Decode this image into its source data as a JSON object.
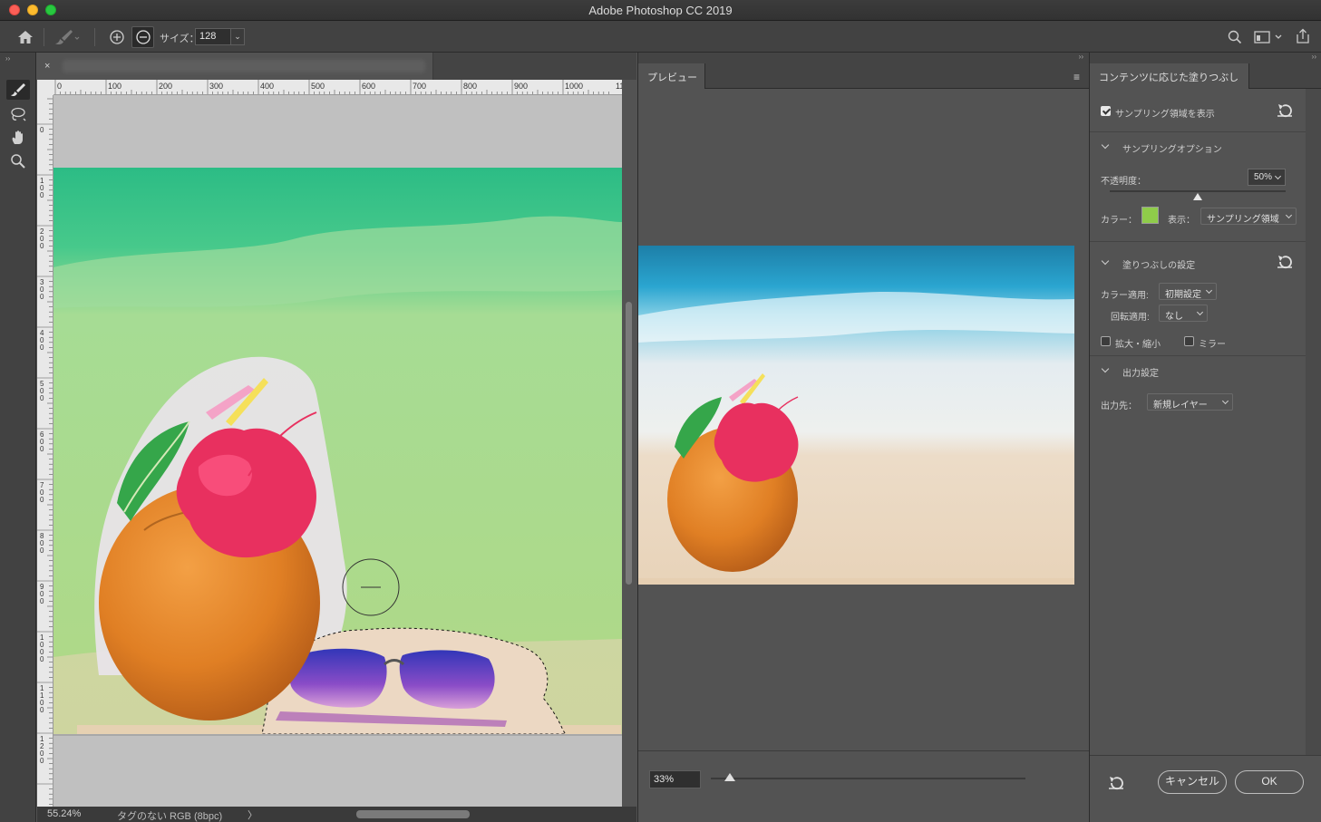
{
  "window": {
    "title": "Adobe Photoshop CC 2019"
  },
  "options_bar": {
    "size_label": "サイズ：",
    "size_value": "128"
  },
  "document": {
    "close_label": "×",
    "zoom": "55.24%",
    "color_info": "タグのない RGB (8bpc)",
    "status_arrow": "〉",
    "ruler_h": [
      "0",
      "100",
      "200",
      "300",
      "400",
      "500",
      "600",
      "700",
      "800",
      "900",
      "1000",
      "1100"
    ],
    "ruler_v": [
      "100",
      "0",
      "100",
      "200",
      "300",
      "400",
      "500",
      "600",
      "700",
      "800",
      "900",
      "1000",
      "1100",
      "1200"
    ]
  },
  "preview": {
    "tab_label": "プレビュー",
    "zoom_value": "33%",
    "zoom_fraction": 0.06
  },
  "settings": {
    "tab_label": "コンテンツに応じた塗りつぶし",
    "show_sampling_label": "サンプリング領域を表示",
    "show_sampling_checked": true,
    "sampling_section": "サンプリングオプション",
    "opacity_label": "不透明度：",
    "opacity_value": "50%",
    "opacity_fraction": 0.5,
    "color_label": "カラー：",
    "color_swatch": "#8fcc4a",
    "display_label": "表示：",
    "display_value": "サンプリング領域",
    "fill_section": "塗りつぶしの設定",
    "color_adapt_label": "カラー適用:",
    "color_adapt_value": "初期設定",
    "rotation_label": "回転適用:",
    "rotation_value": "なし",
    "scale_label": "拡大・縮小",
    "scale_checked": false,
    "mirror_label": "ミラー",
    "mirror_checked": false,
    "output_section": "出力設定",
    "output_label": "出力先：",
    "output_value": "新規レイヤー",
    "cancel_label": "キャンセル",
    "ok_label": "OK"
  },
  "colors": {
    "accent_panel": "#535353",
    "sampling_overlay": "#7fd06a"
  }
}
